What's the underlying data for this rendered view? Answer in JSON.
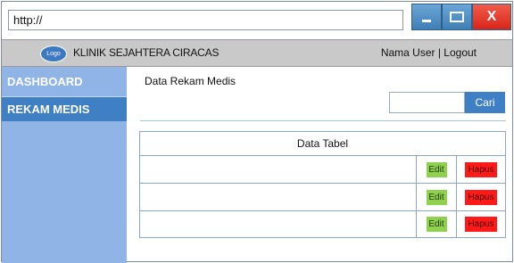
{
  "browser": {
    "url": "http://",
    "close_label": "X"
  },
  "header": {
    "logo_text": "Logo",
    "title": "KLINIK SEJAHTERA CIRACAS",
    "user_nav": "Nama User | Logout"
  },
  "sidebar": {
    "items": [
      {
        "label": "DASHBOARD"
      },
      {
        "label": "REKAM MEDIS"
      }
    ]
  },
  "main": {
    "title": "Data Rekam Medis",
    "search": {
      "placeholder": "",
      "value": "",
      "button_label": "Cari"
    },
    "table": {
      "header": "Data Tabel",
      "rows": [
        {
          "content": "",
          "edit_label": "Edit",
          "delete_label": "Hapus"
        },
        {
          "content": "",
          "edit_label": "Edit",
          "delete_label": "Hapus"
        },
        {
          "content": "",
          "edit_label": "Edit",
          "delete_label": "Hapus"
        }
      ]
    }
  },
  "colors": {
    "sidebar": "#91b4e6",
    "accent": "#3f7fc4",
    "edit": "#8fd14f",
    "delete": "#ff1a1a",
    "header_bar": "#c9c9c9"
  }
}
